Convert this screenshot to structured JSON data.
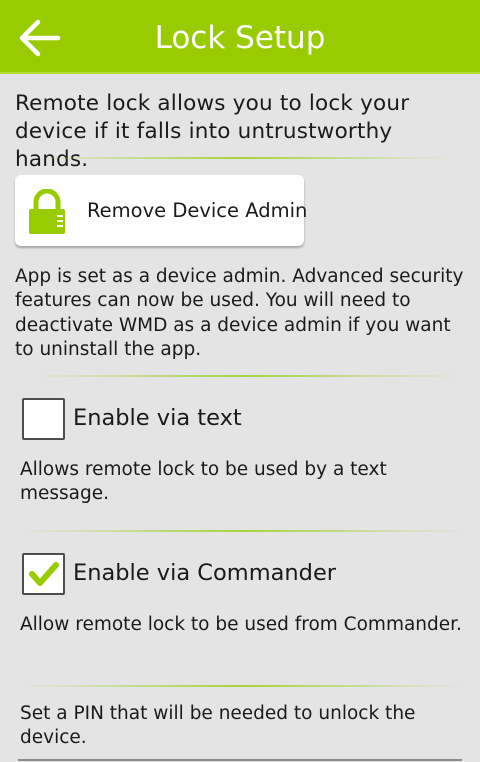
{
  "header": {
    "title": "Lock Setup",
    "back_icon": "back-arrow-icon",
    "color": "#99cc00"
  },
  "intro": {
    "text": "Remote lock allows you to lock your device if it falls into untrustworthy hands."
  },
  "admin": {
    "button_label": "Remove Device Admin",
    "icon": "lock-icon",
    "description": "App is set as a device admin. Advanced security features can now be used. You will need to deactivate WMD as a device admin if you want to uninstall the app."
  },
  "options": [
    {
      "label": "Enable via text",
      "checked": false,
      "description": "Allows remote lock to be used by a text message."
    },
    {
      "label": "Enable via Commander",
      "checked": true,
      "description": "Allow remote lock to be used from Commander."
    }
  ],
  "pin": {
    "description": "Set a PIN that will be needed to unlock the device."
  }
}
